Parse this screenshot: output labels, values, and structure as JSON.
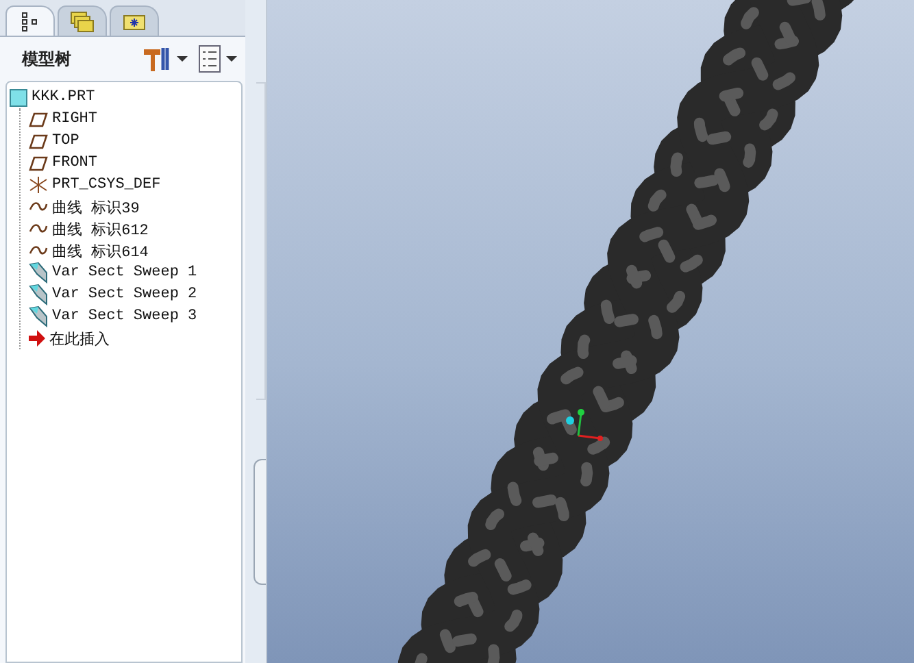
{
  "tabs": [
    {
      "kind": "tree",
      "selected": true
    },
    {
      "kind": "folders",
      "selected": false
    },
    {
      "kind": "favorites",
      "selected": false
    }
  ],
  "panel": {
    "title": "模型树"
  },
  "tree": {
    "label": "KKK.PRT",
    "kind": "part",
    "children": [
      {
        "label": "RIGHT",
        "kind": "plane"
      },
      {
        "label": "TOP",
        "kind": "plane"
      },
      {
        "label": "FRONT",
        "kind": "plane"
      },
      {
        "label": "PRT_CSYS_DEF",
        "kind": "csys"
      },
      {
        "label": "曲线 标识39",
        "kind": "curve"
      },
      {
        "label": "曲线 标识612",
        "kind": "curve"
      },
      {
        "label": "曲线 标识614",
        "kind": "curve"
      },
      {
        "label": "Var Sect Sweep 1",
        "kind": "sweep"
      },
      {
        "label": "Var Sect Sweep 2",
        "kind": "sweep"
      },
      {
        "label": "Var Sect Sweep 3",
        "kind": "sweep"
      },
      {
        "label": "在此插入",
        "kind": "insert"
      }
    ]
  }
}
